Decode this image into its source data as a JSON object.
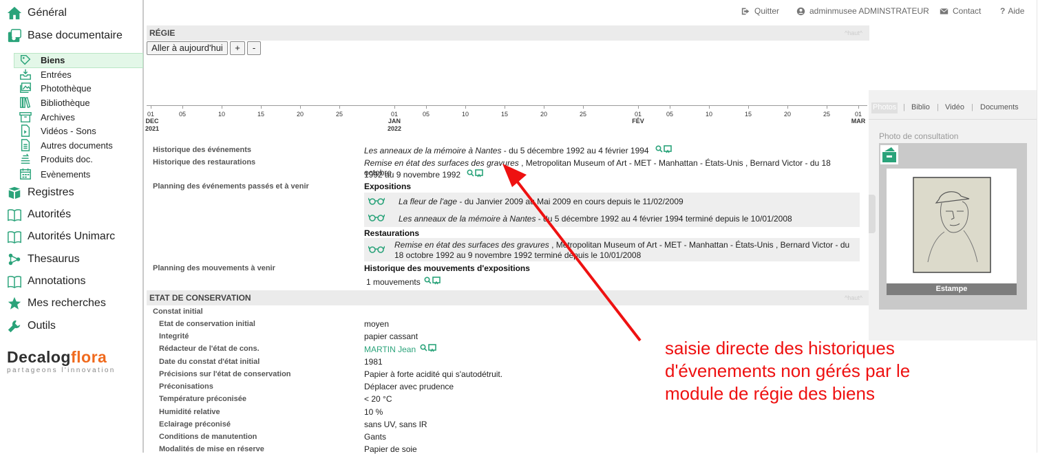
{
  "sidebar": {
    "items": [
      {
        "label": "Général",
        "icon": "home-icon"
      },
      {
        "label": "Base documentaire",
        "icon": "database-icon"
      },
      {
        "label": "Registres",
        "icon": "books-icon"
      },
      {
        "label": "Autorités",
        "icon": "open-book-icon"
      },
      {
        "label": "Autorités Unimarc",
        "icon": "open-book-icon"
      },
      {
        "label": "Thesaurus",
        "icon": "thesaurus-icon"
      },
      {
        "label": "Annotations",
        "icon": "open-book-icon"
      },
      {
        "label": "Mes recherches",
        "icon": "star-icon"
      },
      {
        "label": "Outils",
        "icon": "wrench-icon"
      }
    ],
    "subitems": [
      {
        "label": "Biens",
        "icon": "tag-icon",
        "active": true
      },
      {
        "label": "Entrées",
        "icon": "inbox-icon"
      },
      {
        "label": "Photothèque",
        "icon": "photo-icon"
      },
      {
        "label": "Bibliothèque",
        "icon": "library-icon"
      },
      {
        "label": "Archives",
        "icon": "archive-icon"
      },
      {
        "label": "Vidéos - Sons",
        "icon": "video-icon"
      },
      {
        "label": "Autres documents",
        "icon": "document-icon"
      },
      {
        "label": "Produits doc.",
        "icon": "products-icon"
      },
      {
        "label": "Evènements",
        "icon": "calendar-icon"
      }
    ],
    "logo": {
      "part1": "Decalog",
      "part2": "flora",
      "tagline": "partageons l'innovation"
    }
  },
  "topbar": {
    "quit": "Quitter",
    "user": "adminmusee ADMINSTRATEUR",
    "contact": "Contact",
    "help": "Aide"
  },
  "regie": {
    "title": "RÉGIE",
    "haut": "^haut^",
    "today_button": "Aller à aujourd'hui",
    "plus_button": "+",
    "minus_button": "-",
    "timeline": {
      "day_ticks": [
        "01",
        "05",
        "10",
        "15",
        "20",
        "25",
        "01",
        "05",
        "10",
        "15",
        "20",
        "25",
        "01",
        "05",
        "10",
        "15",
        "20",
        "25",
        "01"
      ],
      "months": [
        {
          "month": "DEC",
          "year": "2021"
        },
        {
          "month": "JAN",
          "year": "2022"
        },
        {
          "month": "FÉV",
          "year": ""
        },
        {
          "month": "MAR",
          "year": ""
        }
      ]
    }
  },
  "fields": {
    "hist_events_label": "Historique des événements",
    "hist_events_title": "Les anneaux de la mémoire à Nantes",
    "hist_events_rest": " - du 5 décembre 1992 au 4 février 1994",
    "hist_rest_label": "Historique des restaurations",
    "hist_rest_title": "Remise en état des surfaces des gravures",
    "hist_rest_rest1": " , Metropolitan Museum of Art - MET - Manhattan - États-Unis ,  Bernard Victor - du 18 octobre",
    "hist_rest_rest2": "1992 au 9 novembre 1992",
    "planning_label": "Planning des événements passés et à venir",
    "expositions_heading": "Expositions",
    "expo1_title": "La fleur de l'age",
    "expo1_rest": " - du Janvier 2009 au Mai 2009  en cours depuis le 11/02/2009",
    "expo2_title": "Les anneaux de la mémoire à Nantes",
    "expo2_rest": " - du 5 décembre 1992 au 4 février 1994  terminé depuis le 10/01/2008",
    "restaurations_heading": "Restaurations",
    "rest1_title": "Remise en état des surfaces des gravures",
    "rest1_rest1": " , Metropolitan Museum of Art - MET - Manhattan - États-Unis ,  Bernard Victor - du",
    "rest1_rest2": "18 octobre 1992 au 9 novembre 1992  terminé depuis le 10/01/2008",
    "moves_label": "Planning des mouvements à venir",
    "moves_heading": "Historique des mouvements d'expositions",
    "moves_count": "1 mouvements"
  },
  "conservation": {
    "title": "ETAT DE CONSERVATION",
    "haut": "^haut^",
    "group": "Constat initial",
    "rows": [
      {
        "label": "Etat de conservation initial",
        "value": "moyen"
      },
      {
        "label": "Integrité",
        "value": "papier cassant"
      },
      {
        "label": "Rédacteur de l'état de cons.",
        "value": "MARTIN Jean"
      },
      {
        "label": "Date du constat d'état initial",
        "value": "1981"
      },
      {
        "label": "Précisions sur l'état de conservation",
        "value": "Papier à forte acidité qui s'autodétruit."
      },
      {
        "label": "Préconisations",
        "value": "Déplacer avec prudence"
      },
      {
        "label": "Température préconisée",
        "value": "< 20 °C"
      },
      {
        "label": "Humidité relative",
        "value": "10 %"
      },
      {
        "label": "Eclairage préconisé",
        "value": "sans UV, sans IR"
      },
      {
        "label": "Conditions de manutention",
        "value": "Gants"
      },
      {
        "label": "Modalités de mise en réserve",
        "value": "Papier de soie"
      }
    ]
  },
  "panel": {
    "tabs": [
      "Photos",
      "Biblio",
      "Vidéo",
      "Documents"
    ],
    "separator": "|",
    "photo_heading": "Photo de consultation",
    "caption": "Estampe"
  },
  "annotation": {
    "lines": [
      "saisie directe des historiques",
      "d'évenements non gérés par  le",
      "module de régie des biens"
    ],
    "color": "#ee1111"
  }
}
